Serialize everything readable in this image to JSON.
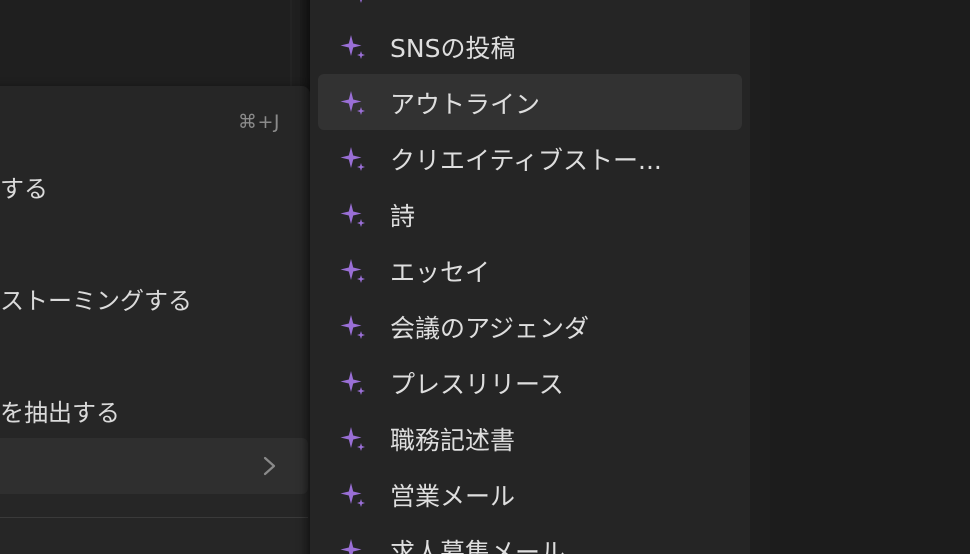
{
  "left_menu": {
    "shortcut": "⌘+J",
    "items": [
      {
        "label": "する"
      },
      {
        "label": "ストーミングする"
      },
      {
        "label": "を抽出する"
      }
    ]
  },
  "submenu": {
    "icon": "sparkle-icon",
    "accent_color": "#9a6fd6",
    "items": [
      {
        "label": "SNSの投稿"
      },
      {
        "label": "アウトライン",
        "active": true
      },
      {
        "label": "クリエイティブストー..."
      },
      {
        "label": "詩"
      },
      {
        "label": "エッセイ"
      },
      {
        "label": "会議のアジェンダ"
      },
      {
        "label": "プレスリリース"
      },
      {
        "label": "職務記述書"
      },
      {
        "label": "営業メール"
      },
      {
        "label": "求人募集メール"
      }
    ]
  }
}
